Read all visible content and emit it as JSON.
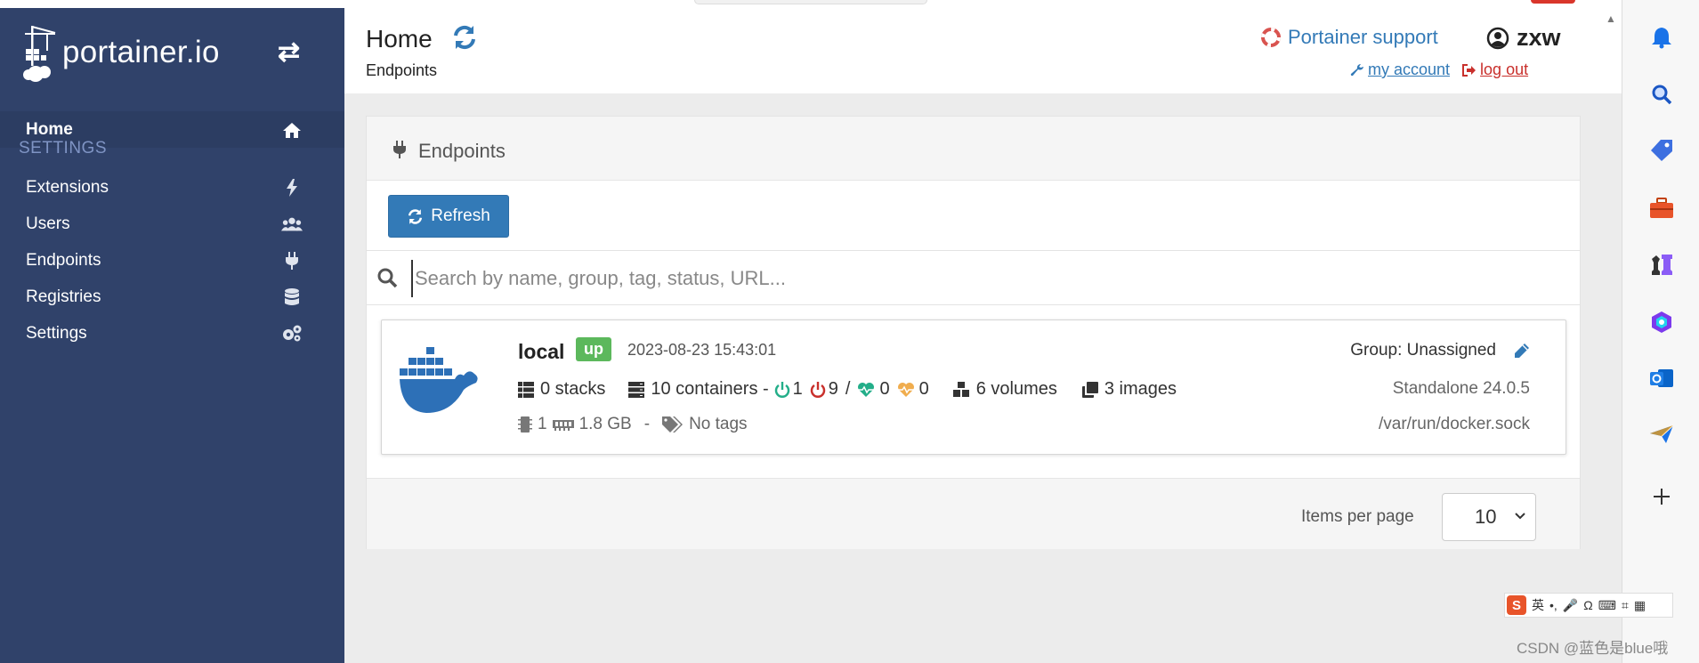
{
  "sidebar": {
    "logo_text": "portainer.io",
    "items": [
      {
        "label": "Home",
        "icon": "home-icon"
      },
      {
        "label": "Extensions",
        "icon": "bolt-icon"
      },
      {
        "label": "Users",
        "icon": "users-icon"
      },
      {
        "label": "Endpoints",
        "icon": "plug-icon"
      },
      {
        "label": "Registries",
        "icon": "database-icon"
      },
      {
        "label": "Settings",
        "icon": "cogs-icon"
      }
    ],
    "settings_heading": "SETTINGS"
  },
  "header": {
    "title": "Home",
    "subtitle": "Endpoints",
    "support_label": "Portainer support",
    "username": "zxw",
    "my_account": " my account ",
    "log_out": " log out"
  },
  "panel": {
    "title": "Endpoints",
    "refresh_label": "Refresh",
    "search_placeholder": "Search by name, group, tag, status, URL..."
  },
  "endpoint": {
    "name": "local",
    "status": "up",
    "timestamp": "2023-08-23 15:43:01",
    "stacks": "0 stacks",
    "containers": "10 containers -",
    "running": "1",
    "stopped": "9",
    "slash": "/",
    "healthy": "0",
    "unhealthy": "0",
    "volumes": "6 volumes",
    "images": "3 images",
    "cpu": "1",
    "memory": "1.8 GB",
    "dash": "-",
    "tags": "No tags",
    "group": "Group: Unassigned",
    "type": "Standalone 24.0.5",
    "url": "/var/run/docker.sock"
  },
  "footer": {
    "items_per_page_label": "Items per page",
    "items_per_page_value": "10"
  },
  "ime": {
    "lang": "英"
  },
  "watermark": "CSDN @蓝色是blue哦",
  "colors": {
    "sidebar": "#30426a",
    "primary": "#337ab7",
    "success": "#5cb85c",
    "danger": "#c9302c",
    "warning": "#f0ad4e"
  }
}
